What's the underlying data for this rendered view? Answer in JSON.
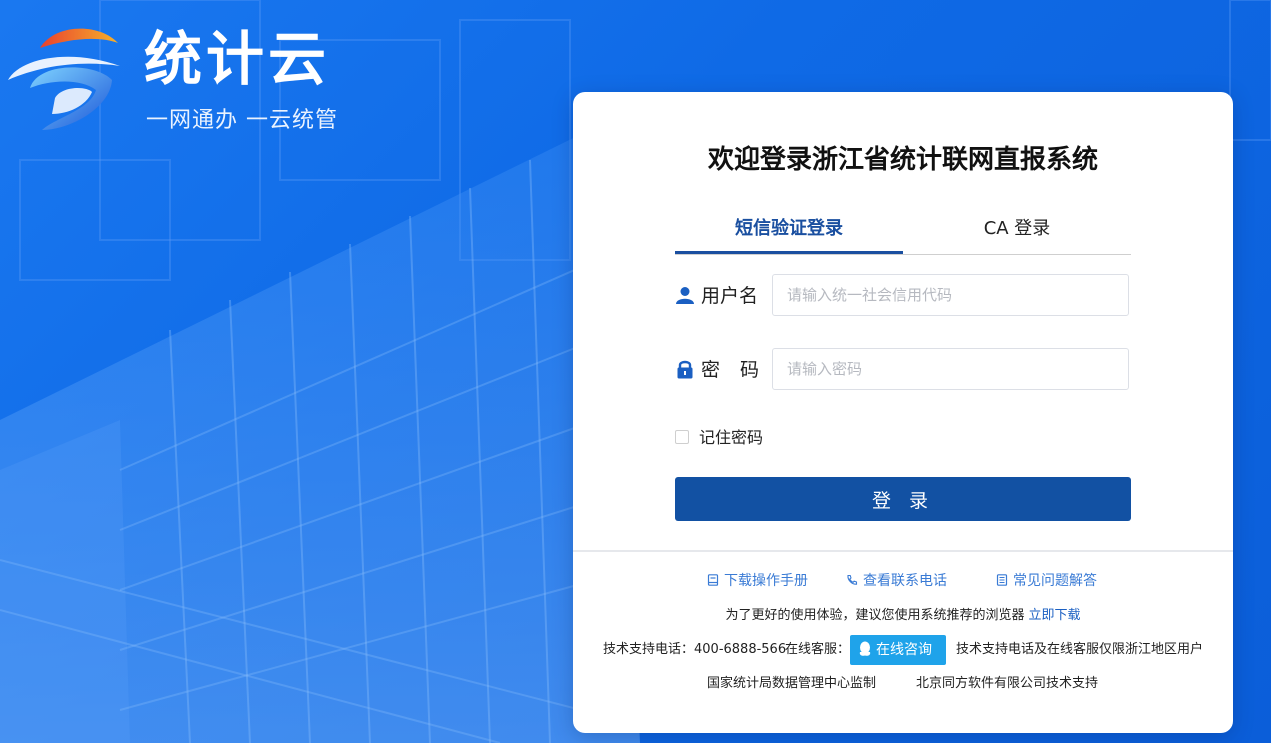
{
  "brand": {
    "title": "统计云",
    "slogan": "一网通办  一云统管"
  },
  "login": {
    "title": "欢迎登录浙江省统计联网直报系统",
    "tabs": [
      {
        "label": "短信验证登录",
        "active": true
      },
      {
        "label": "CA 登录",
        "active": false
      }
    ],
    "username_label": "用户名",
    "username_placeholder": "请输入统一社会信用代码",
    "password_label": "密码",
    "password_placeholder": "请输入密码",
    "remember_label": "记住密码",
    "submit_label": "登 录"
  },
  "links": {
    "manual": "下载操作手册",
    "phone": "查看联系电话",
    "faq": "常见问题解答"
  },
  "tips": {
    "browser_tip": "为了更好的使用体验，建议您使用系统推荐的浏览器",
    "download_now": "立即下载",
    "support_phone": "技术支持电话：400-6888-566",
    "online_service": "在线客服：",
    "consult_button": "在线咨询",
    "support_note": "技术支持电话及在线客服仅限浙江地区用户",
    "supervisor": "国家统计局数据管理中心监制",
    "vendor": "北京同方软件有限公司技术支持"
  },
  "colors": {
    "background": "#1470ea",
    "primary_button": "#1251a3",
    "active_tab": "#1a4fa0",
    "link": "#3a7bd5",
    "consult_button": "#1fa3ea"
  },
  "icons": {
    "username": "user-icon",
    "password": "lock-icon",
    "manual": "document-icon",
    "phone": "phone-icon",
    "faq": "list-icon",
    "consult": "qq-icon"
  }
}
